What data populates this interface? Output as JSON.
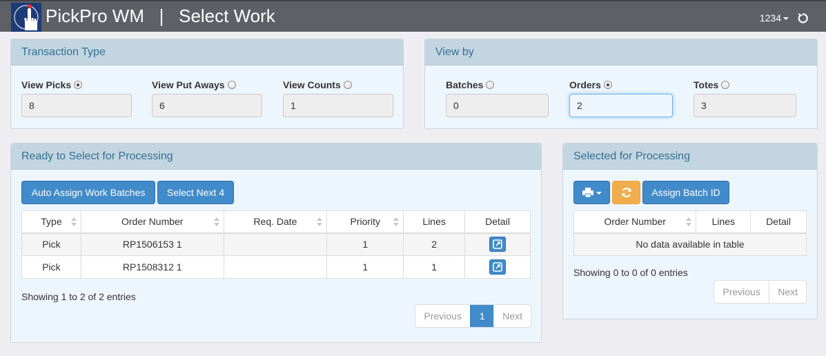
{
  "header": {
    "app_title": "PickPro WM   |   Select Work",
    "user": "1234"
  },
  "transaction_type": {
    "title": "Transaction Type",
    "fields": [
      {
        "label": "View Picks",
        "value": "8",
        "selected": true
      },
      {
        "label": "View Put Aways",
        "value": "6",
        "selected": false
      },
      {
        "label": "View Counts",
        "value": "1",
        "selected": false
      }
    ]
  },
  "view_by": {
    "title": "View by",
    "fields": [
      {
        "label": "Batches",
        "value": "0",
        "selected": false
      },
      {
        "label": "Orders",
        "value": "2",
        "selected": true
      },
      {
        "label": "Totes",
        "value": "3",
        "selected": false
      }
    ]
  },
  "ready": {
    "title": "Ready to Select for Processing",
    "buttons": {
      "auto_assign": "Auto Assign Work Batches",
      "select_next": "Select Next 4"
    },
    "columns": [
      "Type",
      "Order Number",
      "Req. Date",
      "Priority",
      "Lines",
      "Detail"
    ],
    "rows": [
      {
        "type": "Pick",
        "order_number": "RP1506153 1",
        "req_date": "",
        "priority": "1",
        "lines": "2"
      },
      {
        "type": "Pick",
        "order_number": "RP1508312 1",
        "req_date": "",
        "priority": "1",
        "lines": "1"
      }
    ],
    "info": "Showing 1 to 2 of 2 entries",
    "pager": {
      "previous": "Previous",
      "page": "1",
      "next": "Next"
    }
  },
  "selected": {
    "title": "Selected for Processing",
    "buttons": {
      "assign_batch": "Assign Batch ID"
    },
    "columns": [
      "Order Number",
      "Lines",
      "Detail"
    ],
    "empty": "No data available in table",
    "info": "Showing 0 to 0 of 0 entries",
    "pager": {
      "previous": "Previous",
      "next": "Next"
    }
  },
  "colors": {
    "header_bg": "#5d6166",
    "primary": "#428bca",
    "warning": "#f0ad4e",
    "panel_head": "#c3d5e1"
  }
}
